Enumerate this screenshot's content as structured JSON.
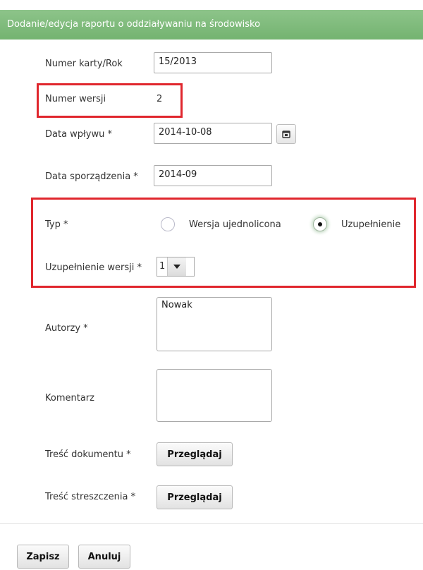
{
  "header": {
    "title": "Dodanie/edycja raportu o oddziaływaniu na środowisko"
  },
  "form": {
    "card_number_label": "Numer karty/Rok",
    "card_number_value": "15/2013",
    "version_label": "Numer wersji",
    "version_value": "2",
    "receipt_date_label": "Data wpływu *",
    "receipt_date_value": "2014-10-08",
    "prepared_date_label": "Data sporządzenia *",
    "prepared_date_value": "2014-09",
    "type_label": "Typ *",
    "type_options": [
      {
        "label": "Wersja ujednolicona",
        "selected": false
      },
      {
        "label": "Uzupełnienie",
        "selected": true
      }
    ],
    "supplement_label": "Uzupełnienie wersji *",
    "supplement_value": "1",
    "authors_label": "Autorzy *",
    "authors_value": "Nowak",
    "comment_label": "Komentarz",
    "comment_value": "",
    "doc_content_label": "Treść dokumentu *",
    "summary_content_label": "Treść streszczenia *",
    "browse_label": "Przeglądaj"
  },
  "footer": {
    "save_label": "Zapisz",
    "cancel_label": "Anuluj"
  },
  "colors": {
    "header": "#7ab976",
    "highlight": "#e0262d"
  },
  "icons": {
    "calendar": "calendar-icon",
    "dropdown": "chevron-down-icon"
  }
}
